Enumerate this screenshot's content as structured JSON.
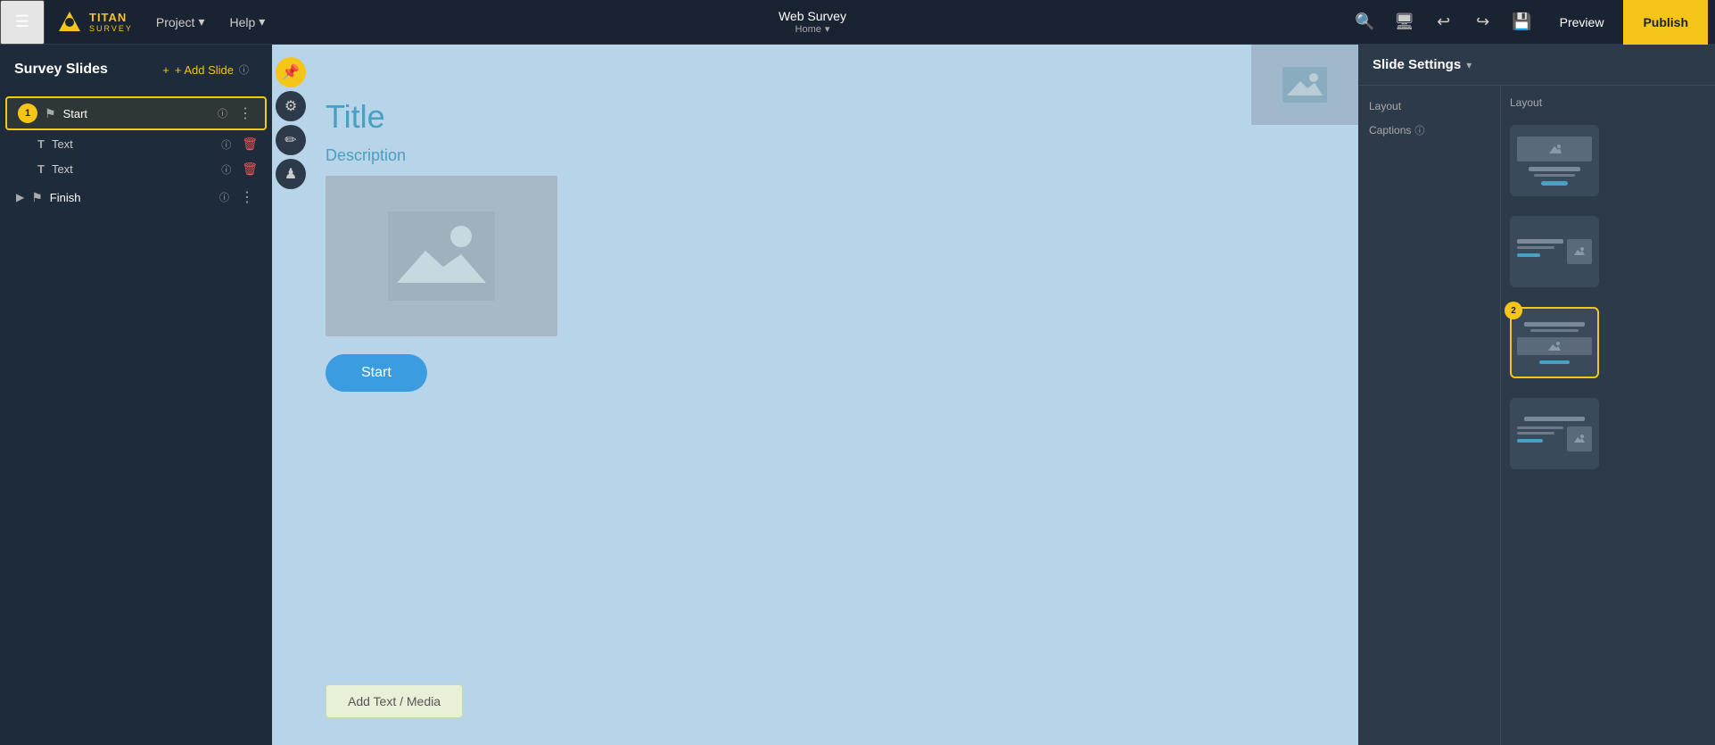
{
  "app": {
    "name": "TITAN",
    "sub": "SURVEY"
  },
  "topnav": {
    "hamburger_label": "☰",
    "project_label": "Project",
    "help_label": "Help",
    "survey_title": "Web Survey",
    "survey_subtitle": "Home",
    "preview_label": "Preview",
    "publish_label": "Publish"
  },
  "sidebar": {
    "title": "Survey Slides",
    "add_slide_label": "+ Add Slide",
    "slides": [
      {
        "number": "1",
        "name": "Start",
        "info": "ⓘ",
        "active": true
      }
    ],
    "sub_items": [
      {
        "icon": "T",
        "label": "Text",
        "info": "ⓘ"
      },
      {
        "icon": "T",
        "label": "Text",
        "info": "ⓘ"
      }
    ],
    "finish_slide": {
      "name": "Finish",
      "info": "ⓘ"
    }
  },
  "toolbar": {
    "pin_icon": "📌",
    "gear_icon": "⚙",
    "pen_icon": "✏",
    "figure_icon": "♟"
  },
  "canvas": {
    "title": "Title",
    "description": "Description",
    "start_button": "Start",
    "add_text_media": "Add Text / Media"
  },
  "right_panel": {
    "title": "Slide Settings",
    "layout_label": "Layout",
    "captions_label": "Captions",
    "captions_info": "ⓘ",
    "layout_right_label": "Layout",
    "selected_layout": 2,
    "layouts": [
      {
        "id": 1,
        "type": "image-top-title-desc-btn"
      },
      {
        "id": 2,
        "type": "title-desc-image-btn"
      },
      {
        "id": 3,
        "type": "title-desc-btn-image"
      },
      {
        "id": 4,
        "type": "title-image-desc-btn"
      }
    ]
  },
  "step_badge_1": "2",
  "colors": {
    "accent": "#f5c518",
    "canvas_bg": "#b8d4e8",
    "title_color": "#4a9fc4",
    "start_btn": "#3b9de0"
  }
}
